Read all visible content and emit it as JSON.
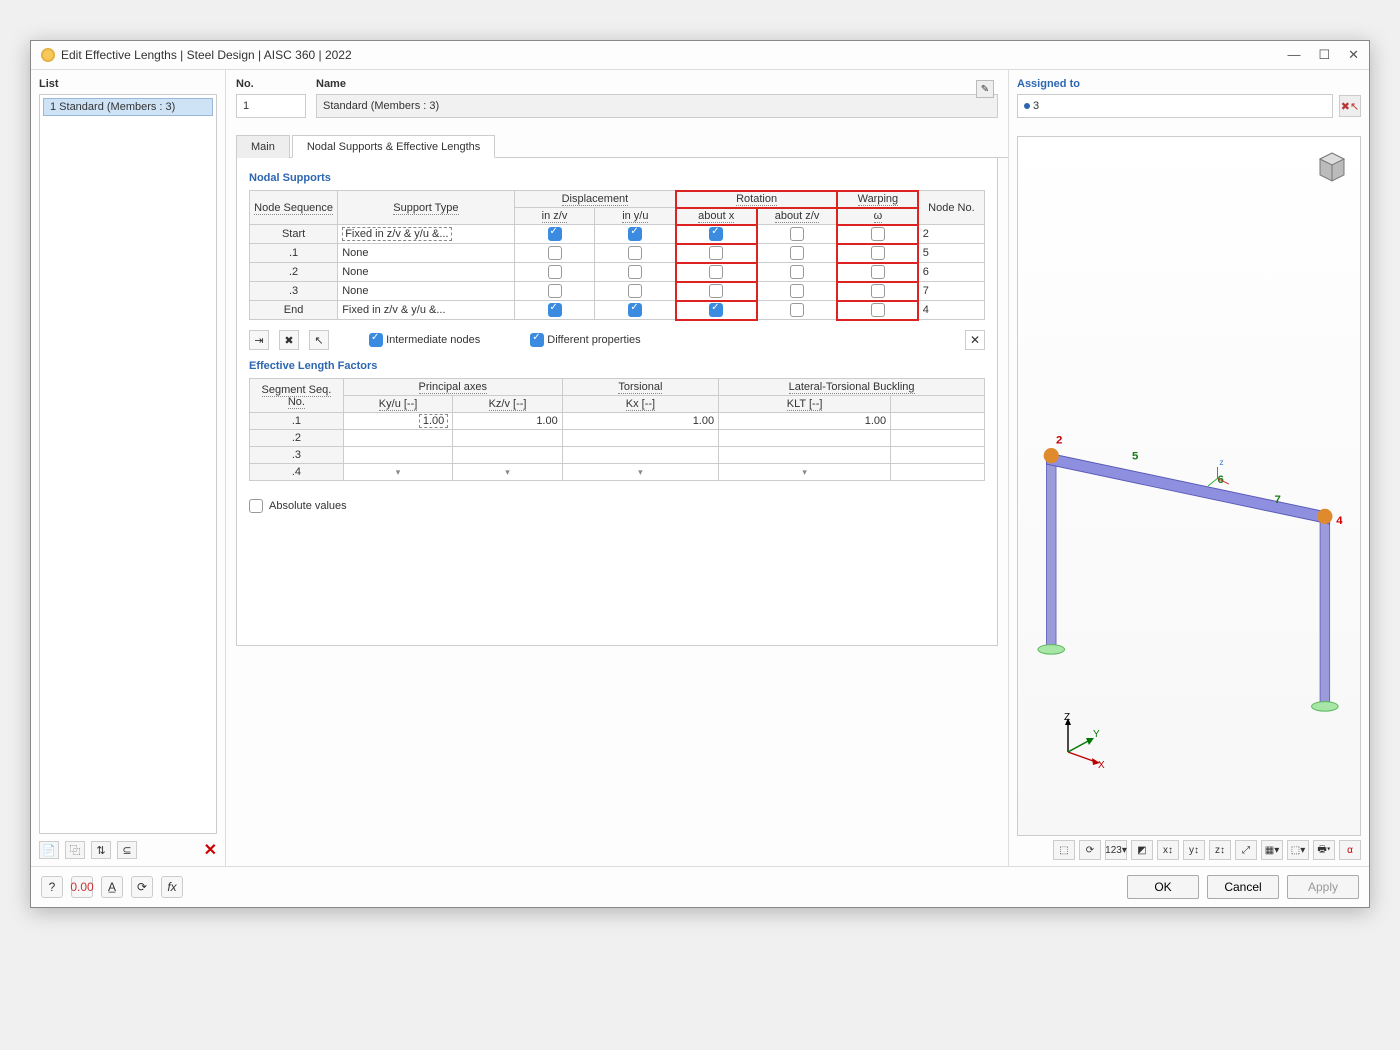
{
  "window": {
    "title": "Edit Effective Lengths | Steel Design | AISC 360 | 2022"
  },
  "list": {
    "label": "List",
    "items": [
      "1 Standard (Members : 3)"
    ]
  },
  "header": {
    "no_label": "No.",
    "no_value": "1",
    "name_label": "Name",
    "name_value": "Standard (Members : 3)",
    "assigned_label": "Assigned to",
    "assigned_value": "3"
  },
  "tabs": {
    "main": "Main",
    "nodal": "Nodal Supports & Effective Lengths"
  },
  "nodal": {
    "heading": "Nodal Supports",
    "cols": {
      "node_seq": "Node Sequence",
      "support_type": "Support Type",
      "displacement": "Displacement",
      "in_zv": "in z/v",
      "in_yu": "in y/u",
      "rotation": "Rotation",
      "about_x": "about x",
      "about_zv": "about z/v",
      "warping": "Warping",
      "omega": "ω",
      "node_no": "Node No."
    },
    "rows": [
      {
        "seq": "Start",
        "type": "Fixed in z/v & y/u &...",
        "zv": true,
        "yu": true,
        "ax": true,
        "azv": false,
        "w": false,
        "node": "2"
      },
      {
        "seq": ".1",
        "type": "None",
        "zv": false,
        "yu": false,
        "ax": false,
        "azv": false,
        "w": false,
        "node": "5"
      },
      {
        "seq": ".2",
        "type": "None",
        "zv": false,
        "yu": false,
        "ax": false,
        "azv": false,
        "w": false,
        "node": "6"
      },
      {
        "seq": ".3",
        "type": "None",
        "zv": false,
        "yu": false,
        "ax": false,
        "azv": false,
        "w": false,
        "node": "7"
      },
      {
        "seq": "End",
        "type": "Fixed in z/v & y/u &...",
        "zv": true,
        "yu": true,
        "ax": true,
        "azv": false,
        "w": false,
        "node": "4"
      }
    ],
    "intermediate_label": "Intermediate nodes",
    "different_label": "Different properties"
  },
  "factors": {
    "heading": "Effective Length Factors",
    "cols": {
      "seg": "Segment Seq. No.",
      "principal": "Principal axes",
      "kyu": "Ky/u [--]",
      "kzv": "Kz/v [--]",
      "torsional": "Torsional",
      "kx": "Kx [--]",
      "ltb": "Lateral-Torsional Buckling",
      "klt": "KLT [--]"
    },
    "rows": [
      {
        "seg": ".1",
        "kyu": "1.00",
        "kzv": "1.00",
        "kx": "1.00",
        "klt": "1.00"
      },
      {
        "seg": ".2",
        "kyu": "",
        "kzv": "",
        "kx": "",
        "klt": ""
      },
      {
        "seg": ".3",
        "kyu": "",
        "kzv": "",
        "kx": "",
        "klt": ""
      },
      {
        "seg": ".4",
        "kyu": "▾",
        "kzv": "▾",
        "kx": "▾",
        "klt": "▾"
      }
    ],
    "absolute_label": "Absolute values"
  },
  "viewer": {
    "node_labels": {
      "n2": "2",
      "n4": "4",
      "n5": "5",
      "n6": "6",
      "n7": "7"
    },
    "axes": {
      "x": "X",
      "y": "Y",
      "z": "Z"
    }
  },
  "footer": {
    "ok": "OK",
    "cancel": "Cancel",
    "apply": "Apply"
  }
}
